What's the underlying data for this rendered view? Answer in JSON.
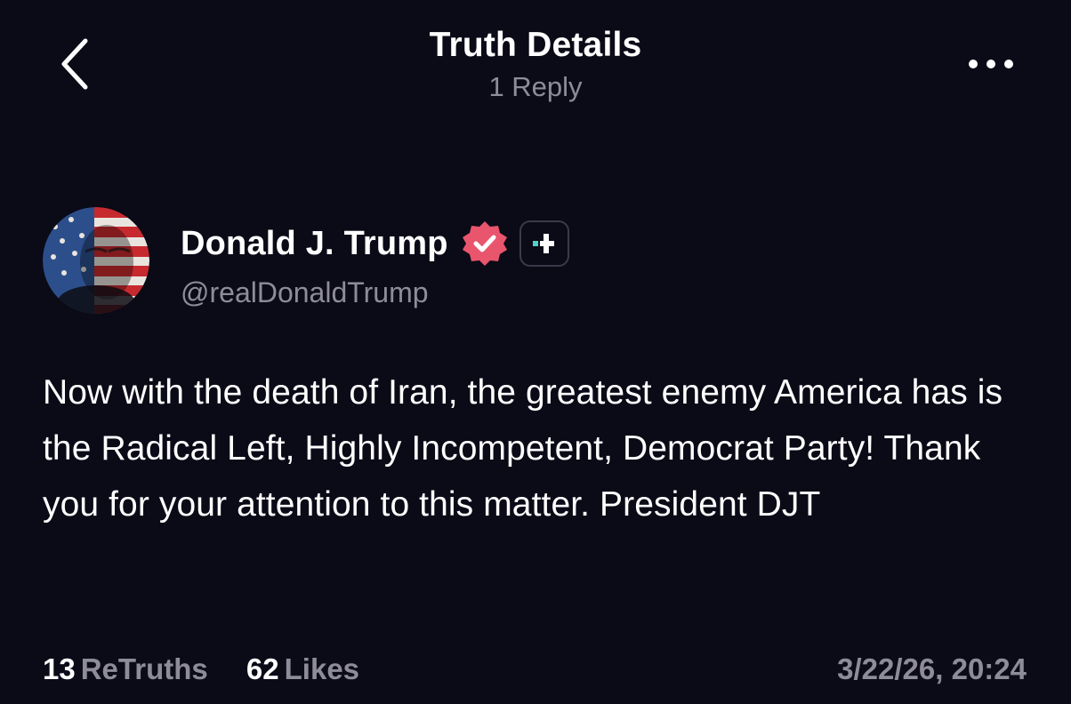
{
  "header": {
    "title": "Truth Details",
    "subtitle": "1 Reply",
    "back_icon": "chevron-left-icon",
    "more_icon": "more-horizontal-icon"
  },
  "post": {
    "author": {
      "name": "Donald J. Trump",
      "handle": "@realDonaldTrump",
      "verified": true,
      "verified_color": "#e8556d"
    },
    "text": "Now with the death of Iran, the greatest enemy America has is the Radical Left, Highly Incompetent, Democrat Party! Thank you for your attention to this matter. President DJT",
    "stats": {
      "retruths_count": "13",
      "retruths_label": "ReTruths",
      "likes_count": "62",
      "likes_label": "Likes"
    },
    "timestamp": "3/22/26, 20:24"
  },
  "colors": {
    "background": "#0b0a17",
    "text_primary": "#ffffff",
    "text_secondary": "#8e8c99",
    "accent": "#4fd1c5"
  }
}
